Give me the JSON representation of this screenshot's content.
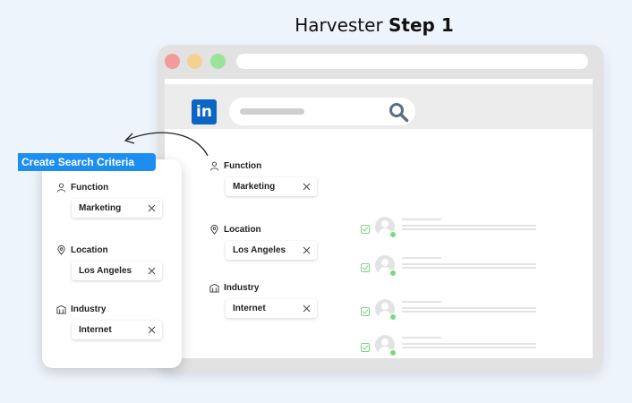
{
  "heading": {
    "normal": "Harvester ",
    "bold": "Step 1"
  },
  "browser": {
    "logo_text": "in"
  },
  "filters": {
    "function": {
      "label": "Function",
      "value": "Marketing",
      "icon": "person-icon"
    },
    "location": {
      "label": "Location",
      "value": "Los Angeles",
      "icon": "location-pin-icon"
    },
    "industry": {
      "label": "Industry",
      "value": "Internet",
      "icon": "building-icon"
    }
  },
  "card": {
    "banner": "Create Search Criteria",
    "function": {
      "label": "Function",
      "value": "Marketing"
    },
    "location": {
      "label": "Location",
      "value": "Los Angeles"
    },
    "industry": {
      "label": "Industry",
      "value": "Internet"
    }
  },
  "colors": {
    "accent": "#1c8ef0",
    "linkedin": "#0a66c2",
    "success": "#7dd87f"
  }
}
